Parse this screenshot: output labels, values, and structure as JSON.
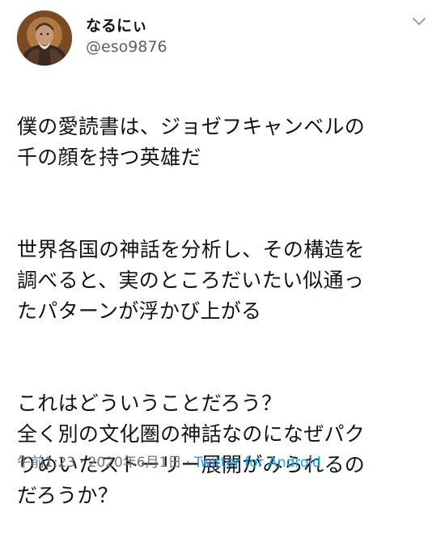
{
  "tweet": {
    "display_name": "なるにぃ",
    "handle": "@eso9876",
    "paragraphs": [
      "僕の愛読書は、ジョゼフキャンベルの\n千の顔を持つ英雄だ",
      "世界各国の神話を分析し、その構造を\n調べると、実のところだいたい似通っ\nたパターンが浮かび上がる",
      "これはどういうことだろう？\n全く別の文化圏の神話なのになぜパク\nりめいたストーリー展開がみられるの\nだろうか？"
    ],
    "time": "午前1:23",
    "date": "2020年6月1日",
    "separator": "·",
    "source": "Twitter for Android"
  },
  "icons": {
    "avatar": "user-avatar",
    "menu": "chevron-down-icon"
  },
  "colors": {
    "text": "#0f1419",
    "secondary": "#586069",
    "link": "#1da1f2"
  }
}
